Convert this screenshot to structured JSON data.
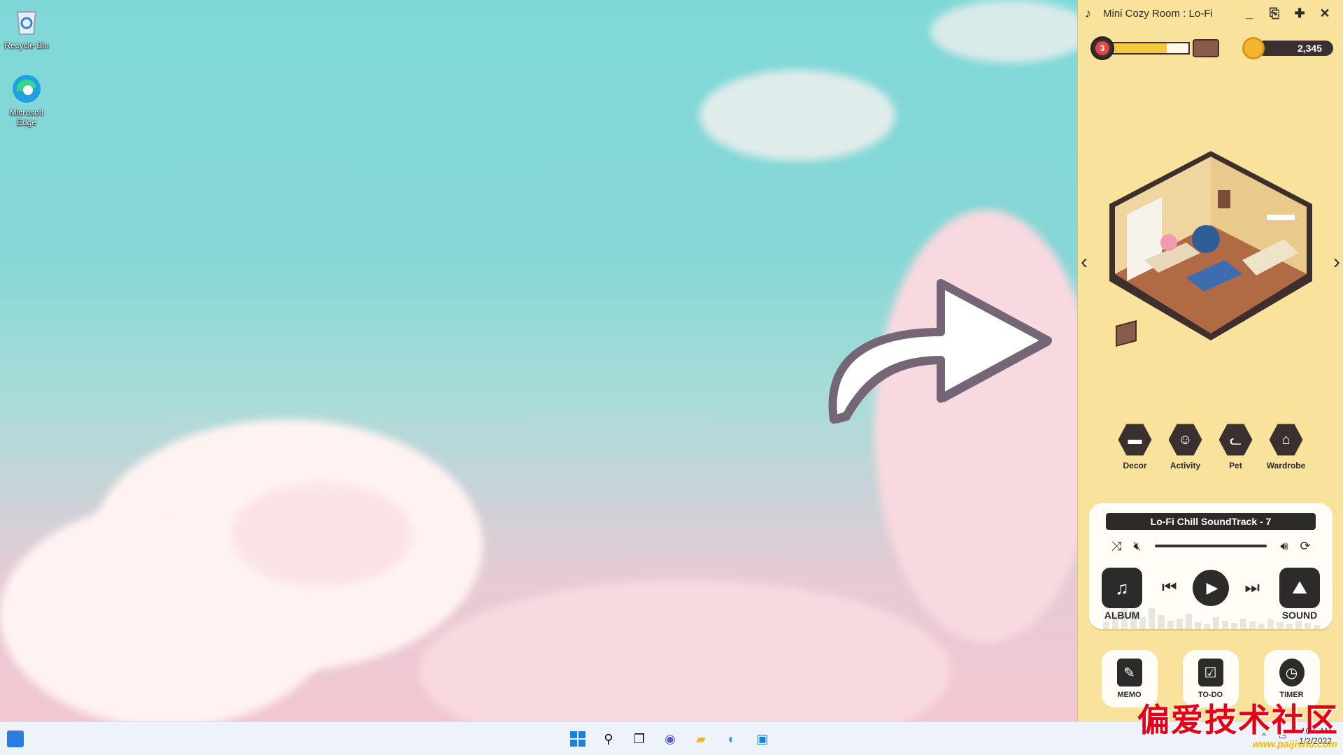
{
  "desktop": {
    "icons": [
      {
        "label": "Recycle Bin",
        "icon": "recycle-bin-icon"
      },
      {
        "label": "Microsoft Edge",
        "icon": "edge-icon"
      }
    ]
  },
  "app": {
    "title": "Mini Cozy Room : Lo-Fi",
    "window_buttons": [
      "minimize",
      "save",
      "puzzle",
      "close"
    ],
    "level": "3",
    "xp_progress": 0.72,
    "coins": "2,345",
    "menu": [
      {
        "label": "Decor",
        "icon": "sofa-icon"
      },
      {
        "label": "Activity",
        "icon": "person-icon"
      },
      {
        "label": "Pet",
        "icon": "cat-icon"
      },
      {
        "label": "Wardrobe",
        "icon": "hanger-icon"
      }
    ],
    "player": {
      "track": "Lo-Fi Chill SoundTrack - 7",
      "album_label": "ALBUM",
      "sound_label": "SOUND"
    },
    "tools": [
      {
        "label": "MEMO",
        "icon": "memo-icon"
      },
      {
        "label": "TO-DO",
        "icon": "clipboard-icon"
      },
      {
        "label": "TIMER",
        "icon": "stopwatch-icon"
      }
    ]
  },
  "taskbar": {
    "clock_time": "10:0 AM",
    "clock_date": "1/2/2022"
  },
  "watermark": {
    "text": "偏爱技术社区",
    "url": "www.paijishu.com"
  },
  "colors": {
    "panel": "#f8e29c",
    "dark": "#2d2a2a",
    "xp": "#f3c93f",
    "coin": "#f2b72e"
  }
}
